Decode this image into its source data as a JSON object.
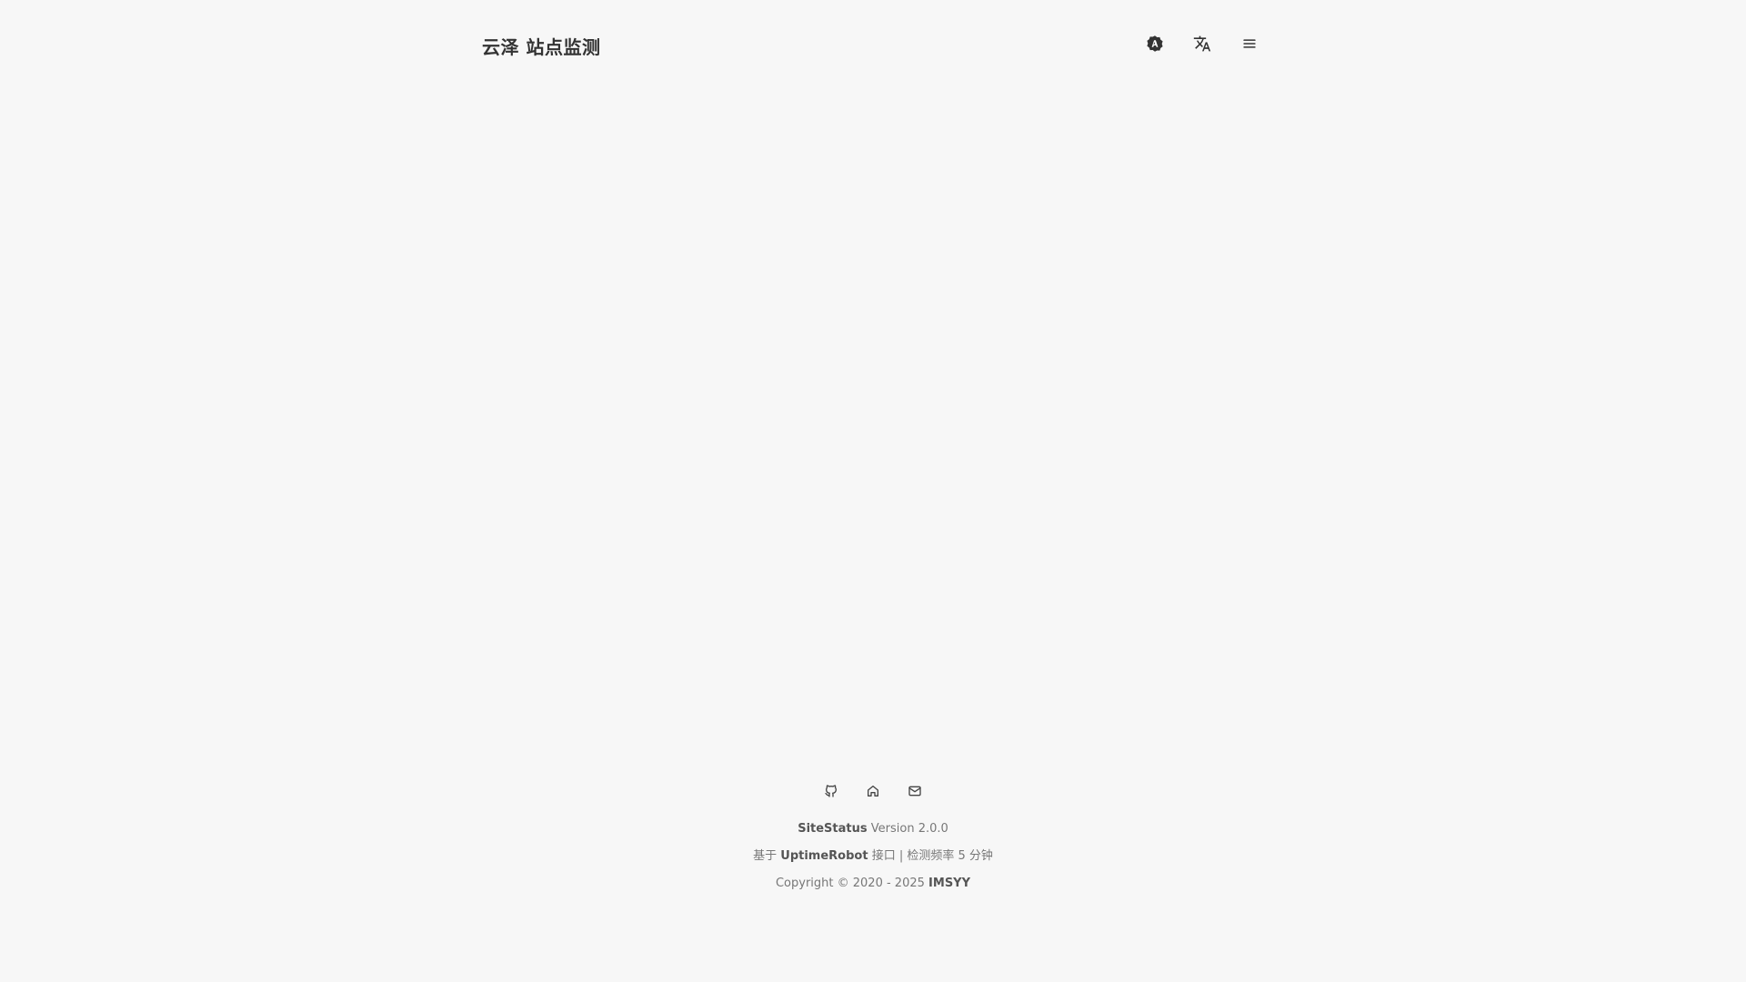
{
  "header": {
    "title": "云泽 站点监测",
    "actions": [
      {
        "icon": "theme-icon"
      },
      {
        "icon": "translate-icon"
      },
      {
        "icon": "menu-icon"
      }
    ]
  },
  "footer": {
    "links": [
      {
        "icon": "github-icon"
      },
      {
        "icon": "home-icon"
      },
      {
        "icon": "mail-icon"
      }
    ],
    "version": {
      "app_name": "SiteStatus",
      "version_text": "Version 2.0.0"
    },
    "based_on": {
      "prefix": "基于",
      "api_name": "UptimeRobot",
      "suffix": "接口 | 检测频率 5 分钟"
    },
    "copyright": {
      "text": "Copyright © 2020 - 2025",
      "owner": "IMSYY"
    }
  }
}
